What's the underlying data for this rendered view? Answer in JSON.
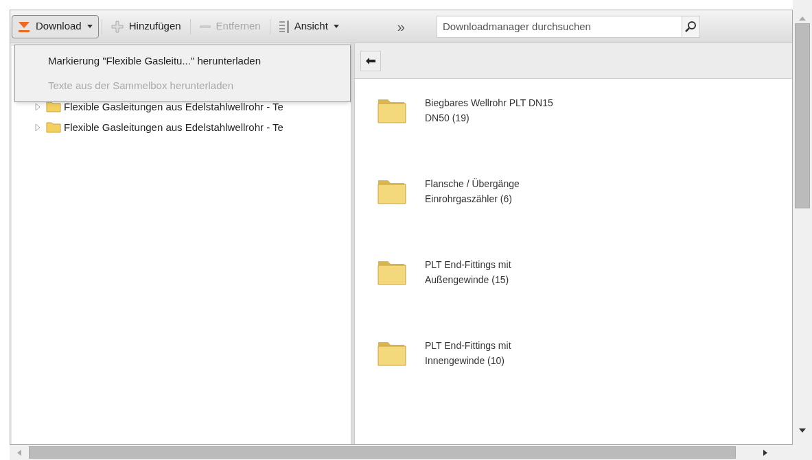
{
  "toolbar": {
    "buttons": [
      {
        "label": "Download",
        "kind": "download",
        "disabled": false,
        "pressed": true,
        "caret": true
      },
      {
        "label": "Hinzufügen",
        "kind": "add",
        "disabled": false,
        "pressed": false,
        "caret": false
      },
      {
        "label": "Entfernen",
        "kind": "remove",
        "disabled": true,
        "pressed": false,
        "caret": false
      },
      {
        "label": "Ansicht",
        "kind": "view",
        "disabled": false,
        "pressed": false,
        "caret": true
      }
    ],
    "overflow": "»",
    "search": {
      "placeholder": "Downloadmanager durchsuchen"
    }
  },
  "download_menu": {
    "items": [
      {
        "label": "Markierung \"Flexible Gasleitu...\" herunterladen",
        "disabled": false
      },
      {
        "label": "Texte aus der Sammelbox herunterladen",
        "disabled": true
      }
    ]
  },
  "tree": {
    "items": [
      {
        "label": "Flexible Gasleitungen aus Edelstahlwellrohr - Te",
        "expanded": false
      },
      {
        "label": "Flexible Gasleitungen aus Edelstahlwellrohr - Te",
        "expanded": false
      }
    ]
  },
  "folders": [
    {
      "label": "Biegbares Wellrohr PLT DN15\nDN50 (19)"
    },
    {
      "label": "Flansche / Übergänge\nEinrohrgaszähler (6)"
    },
    {
      "label": "PLT End-Fittings mit\nAußengewinde (15)"
    },
    {
      "label": "PLT End-Fittings mit\nInnengewinde (10)"
    }
  ]
}
